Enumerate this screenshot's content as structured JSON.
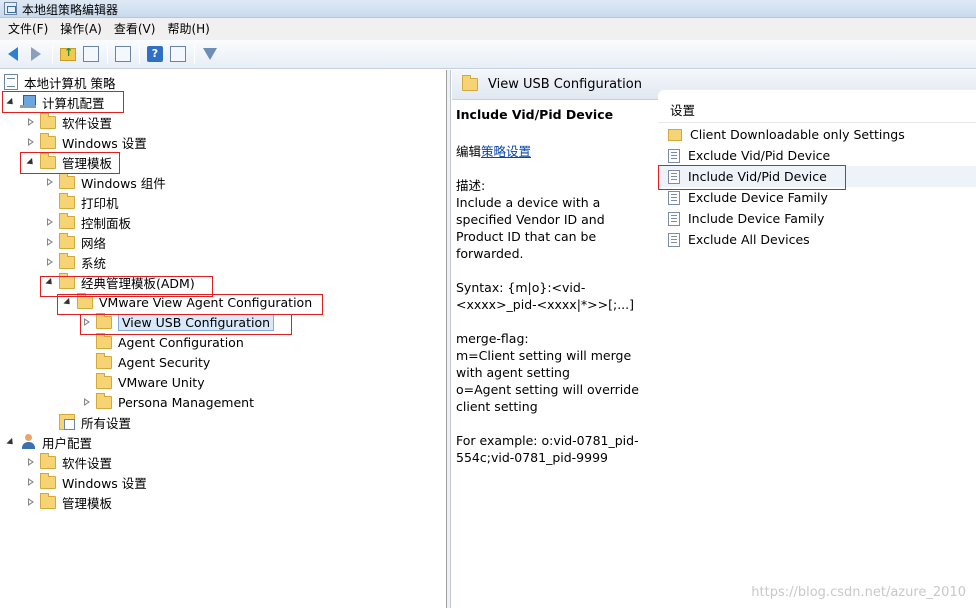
{
  "window": {
    "title": "本地组策略编辑器"
  },
  "menu": [
    "文件(F)",
    "操作(A)",
    "查看(V)",
    "帮助(H)"
  ],
  "toolbar": {
    "icons": [
      "back-icon",
      "forward-icon",
      "up-folder-icon",
      "show-hide-tree-icon",
      "export-list-icon",
      "help-icon",
      "properties-icon",
      "filter-icon"
    ]
  },
  "tree": {
    "root": "本地计算机 策略",
    "computer_config": "计算机配置",
    "software_settings": "软件设置",
    "windows_settings": "Windows 设置",
    "admin_templates": "管理模板",
    "windows_components": "Windows 组件",
    "printers": "打印机",
    "control_panel": "控制面板",
    "network": "网络",
    "system": "系统",
    "classic_adm": "经典管理模板(ADM)",
    "vmware_agent": "VMware View Agent Configuration",
    "view_usb": "View USB Configuration",
    "agent_configuration": "Agent Configuration",
    "agent_security": "Agent Security",
    "vmware_unity": "VMware Unity",
    "persona_management": "Persona Management",
    "all_settings": "所有设置",
    "user_config": "用户配置",
    "user_software_settings": "软件设置",
    "user_windows_settings": "Windows 设置",
    "user_admin_templates": "管理模板"
  },
  "right_pane": {
    "header_title": "View USB Configuration",
    "description": {
      "title": "Include Vid/Pid Device",
      "edit_prefix": "编辑",
      "edit_link": "策略设置",
      "desc_label": "描述:",
      "desc_text": "Include a device with a specified Vendor ID and Product ID that can be forwarded.",
      "syntax": "Syntax: {m|o}:<vid-<xxxx>_pid-<xxxx|*>>[;...]",
      "merge_label": "merge-flag:",
      "merge_m": "m=Client setting will merge with agent setting",
      "merge_o": "o=Agent setting will override client setting",
      "example": "For example: o:vid-0781_pid-554c;vid-0781_pid-9999"
    },
    "column_header": "设置",
    "settings": [
      "Client Downloadable only Settings",
      "Exclude Vid/Pid Device",
      "Include Vid/Pid Device",
      "Exclude Device Family",
      "Include Device Family",
      "Exclude All Devices"
    ],
    "selected_setting_index": 2
  },
  "watermark": "https://blog.csdn.net/azure_2010",
  "colors": {
    "highlight_box": "#e02020",
    "link": "#0645ad",
    "selection": "#d9e9f9"
  }
}
